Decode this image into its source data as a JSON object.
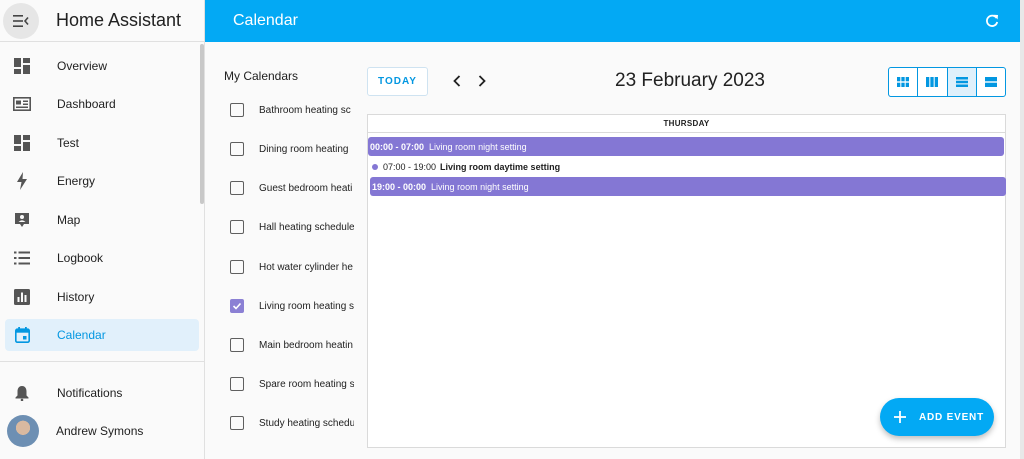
{
  "app": {
    "title": "Home Assistant"
  },
  "sidebar": {
    "items": [
      {
        "label": "Overview",
        "icon": "overview-icon"
      },
      {
        "label": "Dashboard",
        "icon": "dashboard-icon"
      },
      {
        "label": "Test",
        "icon": "test-icon"
      },
      {
        "label": "Energy",
        "icon": "energy-icon"
      },
      {
        "label": "Map",
        "icon": "map-icon"
      },
      {
        "label": "Logbook",
        "icon": "logbook-icon"
      },
      {
        "label": "History",
        "icon": "history-icon"
      },
      {
        "label": "Calendar",
        "icon": "calendar-icon",
        "active": true
      }
    ],
    "notifications_label": "Notifications",
    "user_name": "Andrew Symons"
  },
  "topbar": {
    "title": "Calendar"
  },
  "calendars": {
    "heading": "My Calendars",
    "items": [
      {
        "name": "Bathroom heating sc",
        "checked": false
      },
      {
        "name": "Dining room heating",
        "checked": false
      },
      {
        "name": "Guest bedroom heati",
        "checked": false
      },
      {
        "name": "Hall heating schedule",
        "checked": false
      },
      {
        "name": "Hot water cylinder he",
        "checked": false
      },
      {
        "name": "Living room heating s",
        "checked": true
      },
      {
        "name": "Main bedroom heatin",
        "checked": false
      },
      {
        "name": "Spare room heating s",
        "checked": false
      },
      {
        "name": "Study heating schedu",
        "checked": false
      }
    ]
  },
  "toolbar": {
    "today_label": "TODAY",
    "date_title": "23 February 2023"
  },
  "day_view": {
    "day_header": "THURSDAY",
    "events": [
      {
        "time": "00:00 - 07:00",
        "name": "Living room night setting",
        "style": "block"
      },
      {
        "time": "07:00 - 19:00",
        "name": "Living room daytime setting",
        "style": "dot"
      },
      {
        "time": "19:00 - 00:00",
        "name": "Living room night setting",
        "style": "block"
      }
    ]
  },
  "fab": {
    "label": "ADD EVENT"
  },
  "colors": {
    "primary": "#03a9f4",
    "event": "#8477d4",
    "active_bg": "#e1f0fb"
  }
}
